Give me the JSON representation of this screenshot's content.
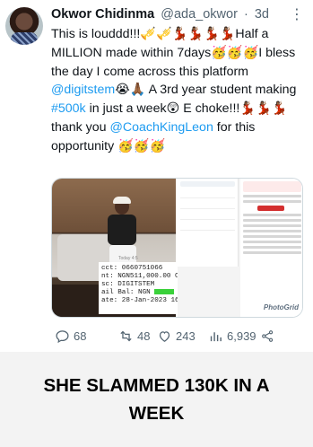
{
  "tweet": {
    "author_name": "Okwor Chidinma",
    "author_handle": "@ada_okwor",
    "separator": "·",
    "time": "3d",
    "more": "⋮",
    "text": {
      "p1": "This is louddd!!!🎺🎺💃🏾💃🏾💃🏾💃🏾Half a MILLION made within 7days🥳🥳🥳I bless the day I come across this platform ",
      "mention1": "@digitstem",
      "p2": "😭🙏🏾 A 3rd year student making ",
      "hashtag": "#500k",
      "p3": " in just a week😲 E choke!!!💃🏾💃🏾💃🏾 thank you ",
      "mention2": "@CoachKingLeon",
      "p4": " for this opportunity 🥳🥳🥳"
    },
    "media": {
      "sms_lines": [
        "cct: 0660751066",
        "nt: NGN511,000.00 CR",
        "sc: DIGITSTEM",
        "ail Bal: NGN",
        "ate: 28-Jan-2023 16:0"
      ],
      "today_label": "Today 4:5",
      "alert_title": "GeNS Transaction Alert [Credit: NGN 511,000.00]",
      "watermark": "PhotoGrid"
    },
    "actions": {
      "replies": "68",
      "retweets": "48",
      "likes": "243",
      "views": "6,939"
    }
  },
  "caption": "SHE SLAMMED 130K IN A WEEK",
  "colors": {
    "link": "#1d9bf0",
    "muted": "#536471",
    "text": "#0f1419",
    "caption_bg": "#f3f3f3"
  }
}
